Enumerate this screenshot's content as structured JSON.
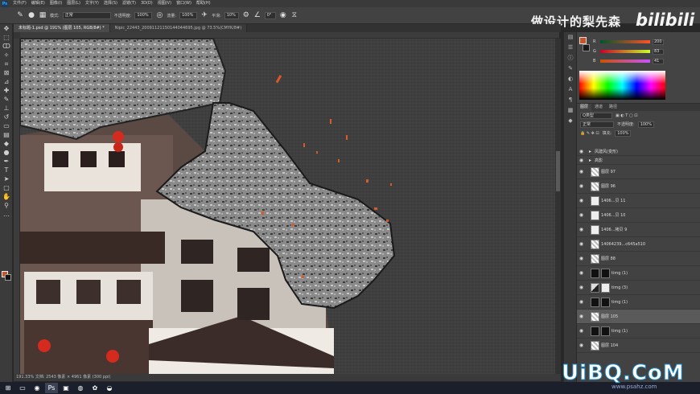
{
  "menubar": {
    "logo": "Ps",
    "items": [
      "文件(F)",
      "编辑(E)",
      "图像(I)",
      "图层(L)",
      "文字(Y)",
      "选择(S)",
      "滤镜(T)",
      "3D(D)",
      "视图(V)",
      "窗口(W)",
      "帮助(H)"
    ]
  },
  "options": {
    "mode_label": "模式:",
    "mode_value": "正常",
    "opacity_label": "不透明度:",
    "opacity_value": "100%",
    "flow_label": "流量:",
    "flow_value": "100%",
    "smooth_label": "平滑:",
    "smooth_value": "10%",
    "angle_value": "0°"
  },
  "tabs": [
    {
      "label": "未标题-1.psd @ 191% (图层 105, RGB/8#) *",
      "active": true
    },
    {
      "label": "Nipic_22443_20091121150144044695.jpg @ 73.5%(CMYK/8#)",
      "active": false
    }
  ],
  "status": {
    "text": "191.33%   文档: 2543 像素 × 4961 像素 (300 ppi)"
  },
  "color_panel": {
    "fg_color": "#c8552a",
    "bg_color": "#1a1a1a",
    "channels": [
      {
        "name": "R",
        "value": "200"
      },
      {
        "name": "G",
        "value": "83"
      },
      {
        "name": "B",
        "value": "41"
      }
    ]
  },
  "layers_panel": {
    "tabs": [
      "图层",
      "通道",
      "路径"
    ],
    "kind_label": "Q类型",
    "blend_mode": "正常",
    "opacity_label": "不透明度:",
    "opacity_value": "100%",
    "fill_label": "填充:",
    "fill_value": "100%",
    "rows": [
      {
        "name": "风建风(变形)",
        "thumb": "folder",
        "folder": true,
        "selected": false
      },
      {
        "name": "高影",
        "thumb": "folder",
        "folder": true,
        "selected": false
      },
      {
        "name": "图层 97",
        "thumb": "check",
        "folder": false,
        "selected": false
      },
      {
        "name": "图层 96",
        "thumb": "check",
        "folder": false,
        "selected": false
      },
      {
        "name": "1406...贝 11",
        "thumb": "white",
        "folder": false,
        "selected": false
      },
      {
        "name": "1406...贝 10",
        "thumb": "white",
        "folder": false,
        "selected": false
      },
      {
        "name": "1406...拷贝 9",
        "thumb": "white",
        "folder": false,
        "selected": false
      },
      {
        "name": "14064239...c645a510",
        "thumb": "check",
        "folder": false,
        "selected": false
      },
      {
        "name": "图层 88",
        "thumb": "check",
        "folder": false,
        "selected": false
      },
      {
        "name": "timg (1)",
        "thumb": "black",
        "folder": false,
        "selected": false
      },
      {
        "name": "timg (3)",
        "thumb": "mix",
        "folder": false,
        "selected": false
      },
      {
        "name": "timg (1)",
        "thumb": "black",
        "folder": false,
        "selected": false
      },
      {
        "name": "图层 105",
        "thumb": "check",
        "folder": false,
        "selected": true
      },
      {
        "name": "timg (1)",
        "thumb": "black",
        "folder": false,
        "selected": false
      },
      {
        "name": "图层 104",
        "thumb": "check",
        "folder": false,
        "selected": false
      }
    ]
  },
  "watermarks": {
    "top_cn": "做设计的梨先森",
    "top_brand": "bilibili",
    "bottom_brand": "UiBQ.CoM",
    "bottom_url": "www.psahz.com"
  },
  "icons": {
    "move": "move-icon",
    "marquee": "marquee-icon",
    "lasso": "lasso-icon",
    "brush": "brush-icon",
    "eye": "eye-icon"
  }
}
